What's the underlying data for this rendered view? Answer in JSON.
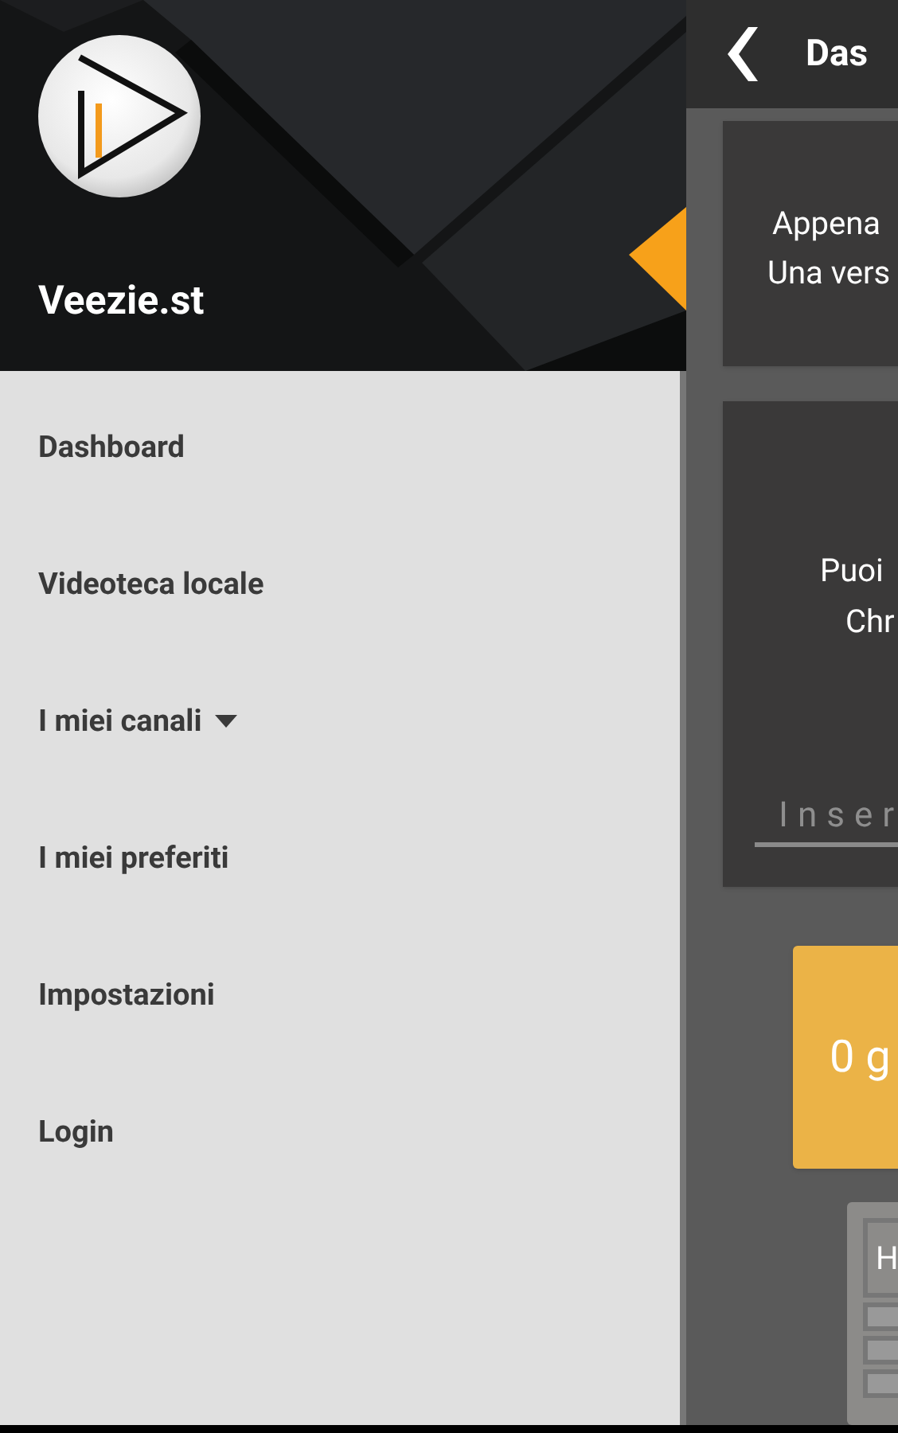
{
  "drawer": {
    "app_name": "Veezie.st",
    "items": [
      {
        "label": "Dashboard",
        "kind": "link"
      },
      {
        "label": "Videoteca locale",
        "kind": "link"
      },
      {
        "label": "I miei canali",
        "kind": "dropdown"
      },
      {
        "label": "I miei preferiti",
        "kind": "link"
      },
      {
        "label": "Impostazioni",
        "kind": "link"
      },
      {
        "label": "Login",
        "kind": "link"
      }
    ]
  },
  "main": {
    "title": "Das",
    "info_card": {
      "lines": [
        "Appena",
        "Una vers"
      ]
    },
    "cast_card": {
      "lines": [
        "Puoi",
        "Chr"
      ],
      "placeholder": "Inser"
    },
    "stat_card": {
      "value": "0 g"
    },
    "table_card": {
      "header": "H"
    }
  }
}
